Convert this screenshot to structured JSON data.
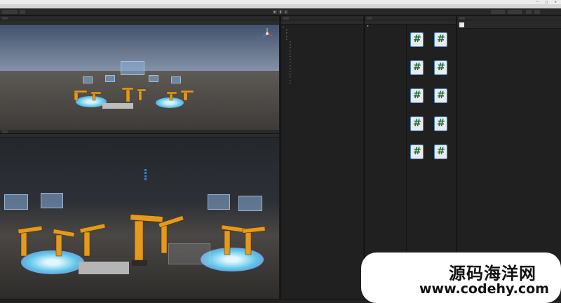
{
  "window": {
    "title": "",
    "controls": [
      "—",
      "□",
      "✕"
    ]
  },
  "menubar": {
    "items": [
      "",
      "",
      "",
      "",
      "",
      "",
      "",
      ""
    ]
  },
  "scene_view": {
    "tab_label": "",
    "gizmo_label": "",
    "hud_lines": [
      "",
      "",
      "",
      "",
      "",
      "",
      "",
      ""
    ]
  },
  "game_view": {
    "tab_label": "",
    "display_label": "",
    "scale_label": "",
    "hud_lines": [
      "",
      "",
      "",
      "",
      "",
      "",
      ""
    ]
  },
  "hierarchy": {
    "tab_label": "",
    "items": [
      {
        "label": "",
        "depth": 0
      },
      {
        "label": "",
        "depth": 1
      },
      {
        "label": "",
        "depth": 1
      },
      {
        "label": "",
        "depth": 1
      },
      {
        "label": "",
        "depth": 1
      },
      {
        "label": "",
        "depth": 2
      },
      {
        "label": "",
        "depth": 3
      },
      {
        "label": "",
        "depth": 3
      },
      {
        "label": "",
        "depth": 3
      },
      {
        "label": "",
        "depth": 3
      },
      {
        "label": "",
        "depth": 3
      },
      {
        "label": "",
        "depth": 3
      },
      {
        "label": "",
        "depth": 3
      },
      {
        "label": "",
        "depth": 3
      },
      {
        "label": "",
        "depth": 3
      },
      {
        "label": "",
        "depth": 3
      },
      {
        "label": "",
        "depth": 3
      },
      {
        "label": "",
        "depth": 3
      },
      {
        "label": "",
        "depth": 3
      },
      {
        "label": "",
        "depth": 3
      },
      {
        "label": "",
        "depth": 3
      },
      {
        "label": "",
        "depth": 3
      },
      {
        "label": "",
        "depth": 3
      },
      {
        "label": "",
        "depth": 3
      },
      {
        "label": "",
        "depth": 3
      },
      {
        "label": "",
        "depth": 3
      },
      {
        "label": "",
        "depth": 3
      },
      {
        "label": "",
        "depth": 3
      },
      {
        "label": "",
        "depth": 3
      },
      {
        "label": "",
        "depth": 3
      },
      {
        "label": "",
        "depth": 3
      },
      {
        "label": "",
        "depth": 3
      },
      {
        "label": "",
        "depth": 3
      },
      {
        "label": "",
        "depth": 3
      },
      {
        "label": "",
        "depth": 3
      },
      {
        "label": "",
        "depth": 3
      },
      {
        "label": "",
        "depth": 2
      },
      {
        "label": "",
        "depth": 2
      },
      {
        "label": "",
        "depth": 2
      },
      {
        "label": "",
        "depth": 2
      },
      {
        "label": "",
        "depth": 2
      },
      {
        "label": "",
        "depth": 2
      },
      {
        "label": "",
        "depth": 2
      },
      {
        "label": "",
        "depth": 2
      },
      {
        "label": "",
        "depth": 2
      },
      {
        "label": "",
        "depth": 2
      },
      {
        "label": "",
        "depth": 2
      },
      {
        "label": "",
        "depth": 2
      },
      {
        "label": "",
        "depth": 2
      },
      {
        "label": "",
        "depth": 2
      }
    ]
  },
  "project": {
    "tab_label": "",
    "favorites": [
      "",
      "",
      "",
      ""
    ],
    "assets": [
      "",
      "",
      "",
      "",
      "",
      "",
      "",
      "",
      "",
      "",
      ""
    ],
    "packages_label": "",
    "breadcrumb": "",
    "scripts": [
      {
        "name": ""
      },
      {
        "name": ""
      },
      {
        "name": ""
      },
      {
        "name": ""
      },
      {
        "name": ""
      },
      {
        "name": ""
      },
      {
        "name": ""
      },
      {
        "name": ""
      },
      {
        "name": ""
      },
      {
        "name": ""
      }
    ],
    "selected_file": ""
  },
  "inspector": {
    "tab_label": "",
    "header": "",
    "imported_label": "",
    "assembly_label": "",
    "assembly_name": "",
    "assembly_value": "",
    "code_lines": [
      "",
      "",
      "",
      "",
      "",
      "",
      "",
      "",
      "",
      "",
      "",
      "",
      "",
      "",
      "",
      "",
      "",
      "",
      "",
      "",
      "",
      "",
      "",
      "",
      "",
      "",
      "",
      "",
      "",
      "",
      "",
      "",
      "",
      "",
      "",
      "",
      "",
      "",
      "",
      "",
      "",
      "",
      "",
      "",
      "",
      "",
      "",
      "",
      "",
      ""
    ]
  },
  "status": {
    "text": ""
  },
  "watermark": {
    "line1": "源码海洋网",
    "line2": "www.codehy.com"
  },
  "colors": {
    "accent_green": "#1c6b3a",
    "robot_orange": "#e49a1c",
    "disc_cyan": "#5cc6e8",
    "disc_purple": "#8a6ad8"
  }
}
